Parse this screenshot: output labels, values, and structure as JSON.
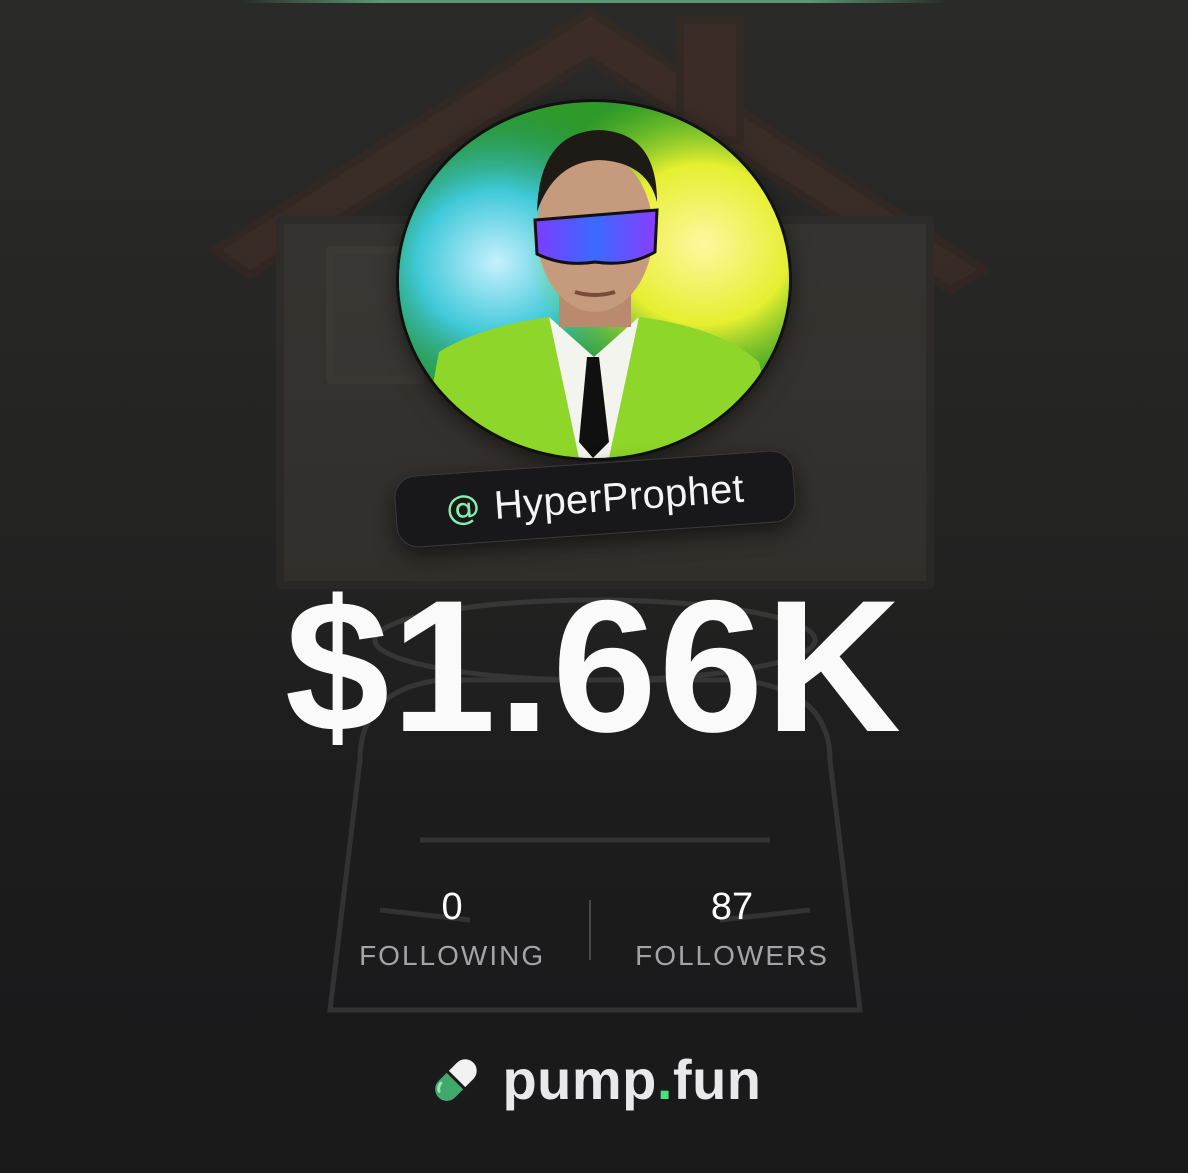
{
  "profile": {
    "handle_prefix": "@",
    "handle": "HyperProphet",
    "value": "$1.66K"
  },
  "stats": {
    "following": {
      "count": "0",
      "label": "FOLLOWING"
    },
    "followers": {
      "count": "87",
      "label": "FOLLOWERS"
    }
  },
  "brand": {
    "name_part1": "pump",
    "name_dot": ".",
    "name_part2": "fun",
    "logo_icon": "pill-icon"
  },
  "colors": {
    "accent_green": "#4ade80",
    "handle_at_color": "#86efac",
    "background": "#1c1c1d",
    "pill_bg": "#18181b",
    "label_gray": "#a3a3a8"
  }
}
